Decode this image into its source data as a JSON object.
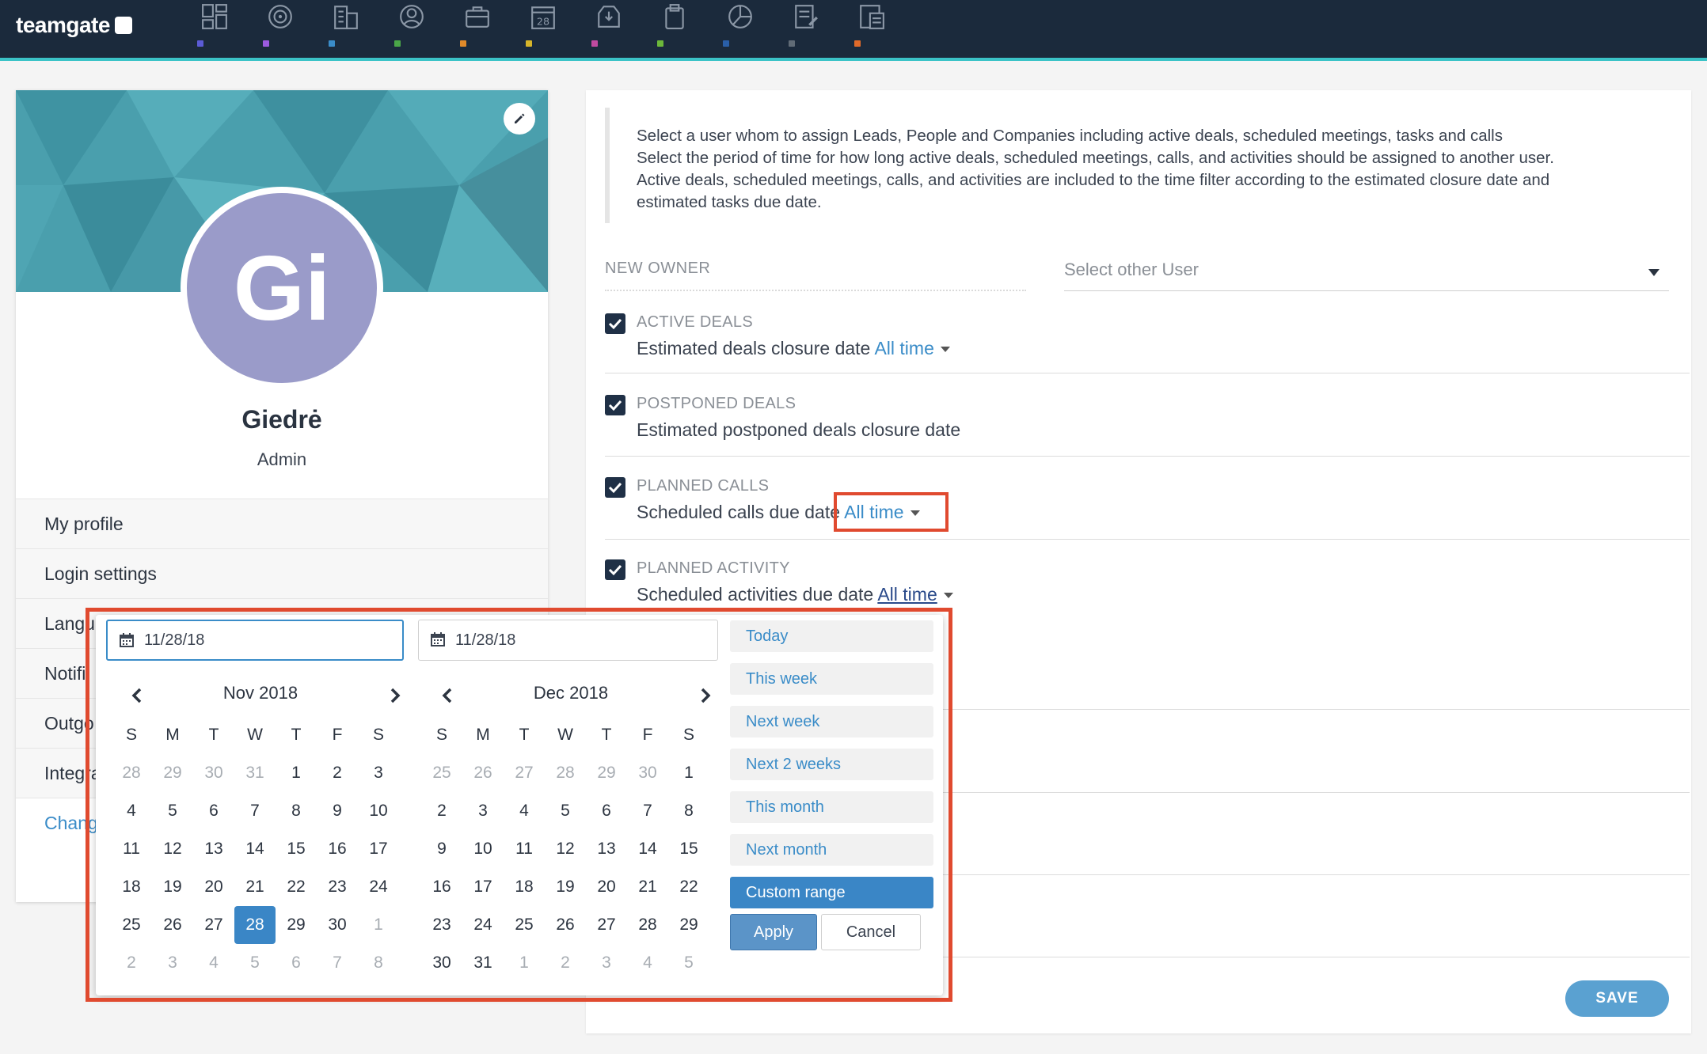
{
  "app": {
    "logo_text": "teamgate"
  },
  "nav": {
    "items": [
      {
        "icon": "dashboard-icon",
        "color": "#5b5bd6"
      },
      {
        "icon": "target-icon",
        "color": "#9b5be0"
      },
      {
        "icon": "companies-icon",
        "color": "#3a8cc8"
      },
      {
        "icon": "people-icon",
        "color": "#4aa648"
      },
      {
        "icon": "deals-icon",
        "color": "#e08a2a"
      },
      {
        "icon": "calendar-icon",
        "label": "28",
        "color": "#d6b52a"
      },
      {
        "icon": "inbox-icon",
        "color": "#c04aa0"
      },
      {
        "icon": "clipboard-icon",
        "color": "#6cb83a"
      },
      {
        "icon": "pie-chart-icon",
        "color": "#2a5fa8"
      },
      {
        "icon": "notes-icon",
        "color": "#606b76"
      },
      {
        "icon": "document-icon",
        "color": "#e06a2a"
      }
    ]
  },
  "profile": {
    "initials": "Gi",
    "name": "Giedrė",
    "role": "Admin",
    "menu": [
      {
        "label": "My profile"
      },
      {
        "label": "Login settings"
      },
      {
        "label": "Langu"
      },
      {
        "label": "Notifi"
      },
      {
        "label": "Outgo"
      },
      {
        "label": "Integra"
      },
      {
        "label": "Chang"
      }
    ]
  },
  "transfer": {
    "info": [
      "Select a user whom to assign Leads, People and Companies including active deals, scheduled meetings, tasks and calls",
      "Select the period of time for how long active deals, scheduled meetings, calls, and activities should be assigned to another user.",
      "Active deals, scheduled meetings, calls, and activities are included to the time filter according to the estimated closure date and",
      "estimated tasks due date."
    ],
    "new_owner_label": "NEW OWNER",
    "owner_placeholder": "Select other User",
    "rows": [
      {
        "title": "ACTIVE DEALS",
        "sub": "Estimated deals closure date",
        "filter": "All time"
      },
      {
        "title": "POSTPONED DEALS",
        "sub": "Estimated postponed deals closure date",
        "filter": ""
      },
      {
        "title": "PLANNED CALLS",
        "sub": "Scheduled calls due date",
        "filter": "All time"
      },
      {
        "title": "PLANNED ACTIVITY",
        "sub": "Scheduled activities due date",
        "filter": "All time"
      }
    ],
    "save_label": "SAVE"
  },
  "datepicker": {
    "start_date": "11/28/18",
    "end_date": "11/28/18",
    "weekdays": [
      "S",
      "M",
      "T",
      "W",
      "T",
      "F",
      "S"
    ],
    "left": {
      "title": "Nov 2018",
      "weeks": [
        [
          "28",
          "29",
          "30",
          "31",
          "1",
          "2",
          "3"
        ],
        [
          "4",
          "5",
          "6",
          "7",
          "8",
          "9",
          "10"
        ],
        [
          "11",
          "12",
          "13",
          "14",
          "15",
          "16",
          "17"
        ],
        [
          "18",
          "19",
          "20",
          "21",
          "22",
          "23",
          "24"
        ],
        [
          "25",
          "26",
          "27",
          "28",
          "29",
          "30",
          "1"
        ],
        [
          "2",
          "3",
          "4",
          "5",
          "6",
          "7",
          "8"
        ]
      ],
      "off": [
        [
          0,
          0
        ],
        [
          0,
          1
        ],
        [
          0,
          2
        ],
        [
          0,
          3
        ],
        [
          4,
          6
        ],
        [
          5,
          0
        ],
        [
          5,
          1
        ],
        [
          5,
          2
        ],
        [
          5,
          3
        ],
        [
          5,
          4
        ],
        [
          5,
          5
        ],
        [
          5,
          6
        ]
      ],
      "selected": [
        4,
        3
      ]
    },
    "right": {
      "title": "Dec 2018",
      "weeks": [
        [
          "25",
          "26",
          "27",
          "28",
          "29",
          "30",
          "1"
        ],
        [
          "2",
          "3",
          "4",
          "5",
          "6",
          "7",
          "8"
        ],
        [
          "9",
          "10",
          "11",
          "12",
          "13",
          "14",
          "15"
        ],
        [
          "16",
          "17",
          "18",
          "19",
          "20",
          "21",
          "22"
        ],
        [
          "23",
          "24",
          "25",
          "26",
          "27",
          "28",
          "29"
        ],
        [
          "30",
          "31",
          "1",
          "2",
          "3",
          "4",
          "5"
        ]
      ],
      "off": [
        [
          0,
          0
        ],
        [
          0,
          1
        ],
        [
          0,
          2
        ],
        [
          0,
          3
        ],
        [
          0,
          4
        ],
        [
          0,
          5
        ],
        [
          5,
          2
        ],
        [
          5,
          3
        ],
        [
          5,
          4
        ],
        [
          5,
          5
        ],
        [
          5,
          6
        ]
      ],
      "selected": null
    },
    "ranges": [
      "Today",
      "This week",
      "Next week",
      "Next 2 weeks",
      "This month",
      "Next month",
      "Custom range"
    ],
    "active_range": "Custom range",
    "apply_label": "Apply",
    "cancel_label": "Cancel"
  },
  "colors": {
    "accent": "#3a86c6",
    "highlight": "#e04a2f",
    "nav_bg": "#1b2a3c"
  }
}
